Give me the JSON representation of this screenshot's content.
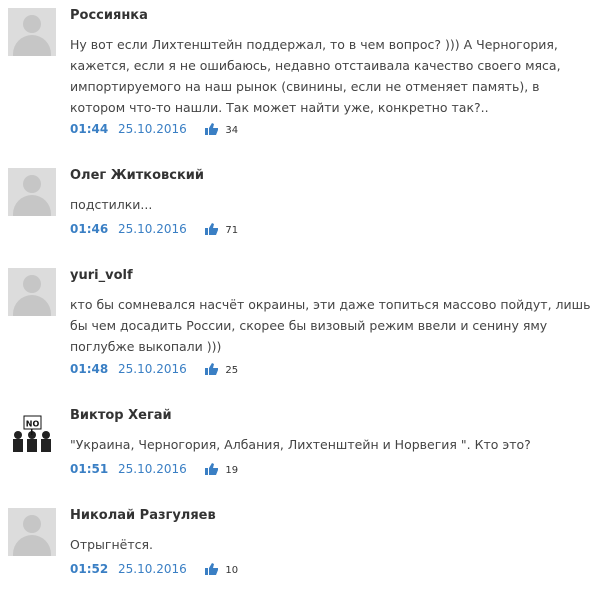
{
  "comments": [
    {
      "author": "Россиянка",
      "text": "Ну вот если Лихтенштейн поддержал, то в чем вопрос? ))) А Черногория, кажется, если я не ошибаюсь, недавно отстаивала качество своего мяса, импортируемого на наш рынок (свинины, если не отменяет память), в котором что-то нашли. Так может найти уже, конкретно так?..",
      "time": "01:44",
      "date": "25.10.2016",
      "likes": "34",
      "avatar": "default-user-icon"
    },
    {
      "author": "Олег Житковский",
      "text": "подстилки...",
      "time": "01:46",
      "date": "25.10.2016",
      "likes": "71",
      "avatar": "default-user-icon"
    },
    {
      "author": "yuri_volf",
      "text": "кто бы сомневался насчёт окраины, эти даже топиться массово пойдут, лишь бы чем досадить России, скорее бы визовый режим ввели и сенину яму поглубже выкопали )))",
      "time": "01:48",
      "date": "25.10.2016",
      "likes": "25",
      "avatar": "default-user-icon"
    },
    {
      "author": "Виктор Хегай",
      "text": "\"Украина, Черногория, Албания, Лихтенштейн и Норвегия \". Кто это?",
      "time": "01:51",
      "date": "25.10.2016",
      "likes": "19",
      "avatar": "custom-photo-avatar",
      "avatar_text": "NO"
    },
    {
      "author": "Николай Разгуляев",
      "text": "Отрыгнётся.",
      "time": "01:52",
      "date": "25.10.2016",
      "likes": "10",
      "avatar": "default-user-icon"
    }
  ],
  "colors": {
    "link": "#3a7fc4",
    "text": "#444444",
    "avatar_bg": "#dcdcdc"
  }
}
